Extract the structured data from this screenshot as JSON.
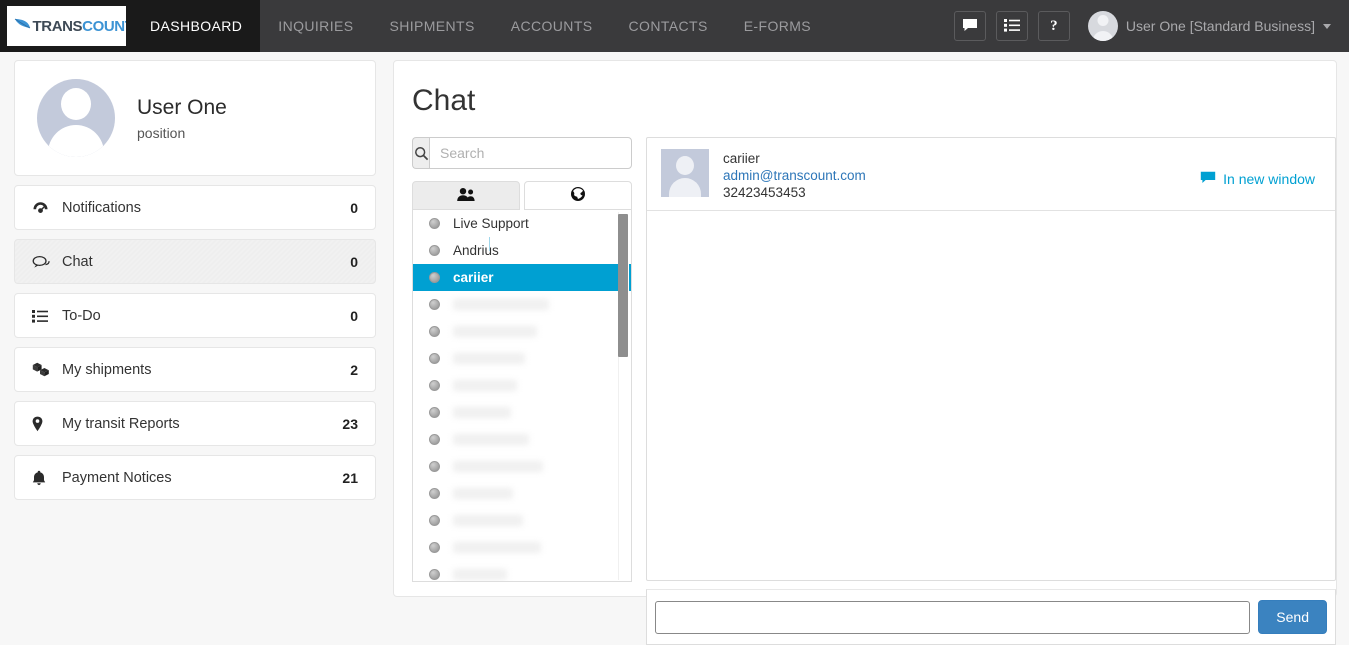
{
  "navbar": {
    "brand": {
      "text_dark": "TRANS",
      "text_blue": "COUNT",
      "leaf_icon": "leaf-icon"
    },
    "items": [
      {
        "label": "DASHBOARD",
        "active": true
      },
      {
        "label": "INQUIRIES",
        "active": false
      },
      {
        "label": "SHIPMENTS",
        "active": false
      },
      {
        "label": "ACCOUNTS",
        "active": false
      },
      {
        "label": "CONTACTS",
        "active": false
      },
      {
        "label": "E-FORMS",
        "active": false
      }
    ],
    "icon_buttons": [
      {
        "name": "chat-bubble-icon"
      },
      {
        "name": "list-icon"
      },
      {
        "name": "help-icon",
        "glyph": "?"
      }
    ],
    "user": {
      "name": "User One [Standard Business]"
    }
  },
  "sidebar": {
    "profile": {
      "name": "User One",
      "position": "position"
    },
    "items": [
      {
        "label": "Notifications",
        "count": "0",
        "icon": "dashboard-gauge-icon",
        "active": false
      },
      {
        "label": "Chat",
        "count": "0",
        "icon": "chat-icon",
        "active": true
      },
      {
        "label": "To-Do",
        "count": "0",
        "icon": "list-icon",
        "active": false
      },
      {
        "label": "My shipments",
        "count": "2",
        "icon": "boxes-icon",
        "active": false
      },
      {
        "label": "My transit Reports",
        "count": "23",
        "icon": "map-pin-icon",
        "active": false
      },
      {
        "label": "Payment Notices",
        "count": "21",
        "icon": "bell-icon",
        "active": false
      }
    ]
  },
  "main": {
    "title": "Chat",
    "search": {
      "value": "",
      "placeholder": "Search",
      "icon": "search-icon"
    },
    "tabs": [
      {
        "name": "tab-contacts",
        "icon": "users-icon",
        "active": true
      },
      {
        "name": "tab-global",
        "icon": "globe-icon",
        "active": false
      }
    ],
    "contacts": [
      {
        "name": "Live Support",
        "selected": false,
        "blurred": false,
        "status": "offline"
      },
      {
        "name": "Andrius",
        "selected": false,
        "blurred": false,
        "status": "offline"
      },
      {
        "name": "cariier",
        "selected": true,
        "blurred": false,
        "status": "offline"
      },
      {
        "name": "",
        "selected": false,
        "blurred": true,
        "status": "offline",
        "blur_width": 96
      },
      {
        "name": "",
        "selected": false,
        "blurred": true,
        "status": "offline",
        "blur_width": 84
      },
      {
        "name": "",
        "selected": false,
        "blurred": true,
        "status": "offline",
        "blur_width": 72
      },
      {
        "name": "",
        "selected": false,
        "blurred": true,
        "status": "offline",
        "blur_width": 64
      },
      {
        "name": "",
        "selected": false,
        "blurred": true,
        "status": "offline",
        "blur_width": 58
      },
      {
        "name": "",
        "selected": false,
        "blurred": true,
        "status": "offline",
        "blur_width": 76
      },
      {
        "name": "",
        "selected": false,
        "blurred": true,
        "status": "offline",
        "blur_width": 90
      },
      {
        "name": "",
        "selected": false,
        "blurred": true,
        "status": "offline",
        "blur_width": 60
      },
      {
        "name": "",
        "selected": false,
        "blurred": true,
        "status": "offline",
        "blur_width": 70
      },
      {
        "name": "",
        "selected": false,
        "blurred": true,
        "status": "offline",
        "blur_width": 88
      },
      {
        "name": "",
        "selected": false,
        "blurred": true,
        "status": "offline",
        "blur_width": 54
      }
    ],
    "conversation": {
      "contact_name": "cariier",
      "contact_email": "admin@transcount.com",
      "contact_phone": "32423453453",
      "new_window_label": "In new window",
      "new_window_icon": "chat-bubble-icon",
      "messages": []
    },
    "compose": {
      "value": "",
      "placeholder": "",
      "send_label": "Send"
    }
  },
  "colors": {
    "accent_cyan": "#00a0d2",
    "link_blue": "#2d76b8",
    "send_blue": "#3b83c0",
    "navbar_bg": "#3a3a3c",
    "navbar_active_bg": "#1a1a1a",
    "page_bg": "#f7f7f7"
  }
}
